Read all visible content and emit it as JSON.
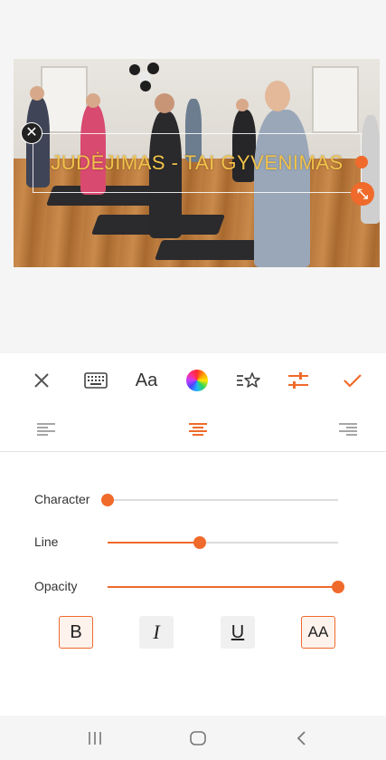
{
  "canvas": {
    "overlay_text": "JUDĖJIMAS - TAI GYVENIMAS",
    "overlay_text_color": "#f2c24a",
    "delete_icon": "close-icon",
    "resize_icon": "resize-diagonal-icon"
  },
  "toolbar": {
    "items": [
      {
        "name": "close-icon",
        "label": "×"
      },
      {
        "name": "keyboard-icon",
        "label": "keyboard"
      },
      {
        "name": "font-icon",
        "label": "Aa"
      },
      {
        "name": "color-wheel-icon",
        "label": "color"
      },
      {
        "name": "text-style-star-icon",
        "label": "style"
      },
      {
        "name": "adjust-sliders-icon",
        "label": "adjust",
        "active": true
      },
      {
        "name": "check-icon",
        "label": "✓"
      }
    ],
    "font_label": "Aa"
  },
  "alignment": {
    "options": [
      "left",
      "center",
      "right"
    ],
    "selected": "center"
  },
  "sliders": {
    "character": {
      "label": "Character",
      "value": 0.0
    },
    "line": {
      "label": "Line",
      "value": 0.4
    },
    "opacity": {
      "label": "Opacity",
      "value": 1.0
    }
  },
  "format": {
    "bold": {
      "label": "B",
      "active": true
    },
    "italic": {
      "label": "I",
      "active": false
    },
    "underline": {
      "label": "U",
      "active": false
    },
    "caps": {
      "label": "AA",
      "active": true
    }
  },
  "colors": {
    "accent": "#f06a2b",
    "text_overlay": "#f2c24a"
  },
  "navbar": {
    "items": [
      "recent-apps-icon",
      "home-icon",
      "back-icon"
    ]
  }
}
